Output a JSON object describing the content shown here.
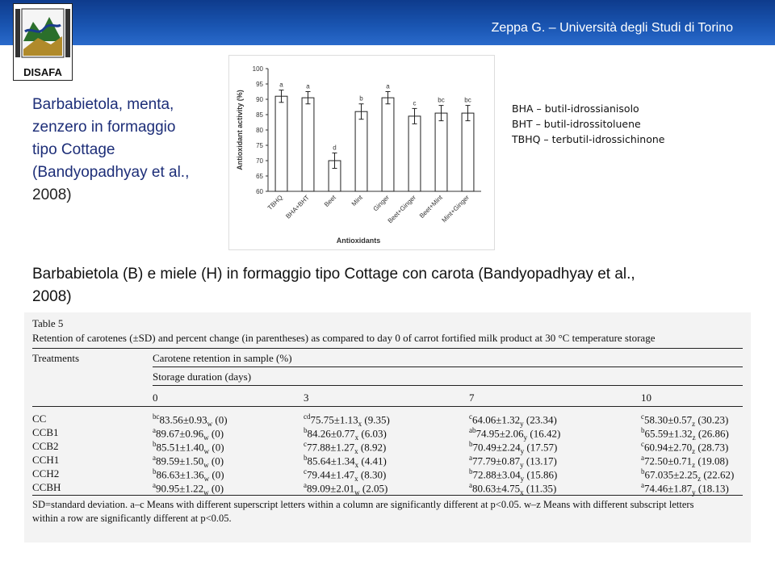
{
  "header": {
    "author_text": "Zeppa G. – Università degli Studi di Torino",
    "logo_text": "DISAFA",
    "logo_ring_text": "UNIVERSITA DEGLI STUDI DI TORINO"
  },
  "left_title": {
    "line1": "Barbabietola, menta,",
    "line2": "zenzero in formaggio",
    "line3": "tipo Cottage",
    "line4": "(Bandyopadhyay et al.,",
    "line5": "2008)"
  },
  "chart_data": {
    "type": "bar",
    "xlabel": "Antioxidants",
    "ylabel": "Antioxidant activity (%)",
    "ylim": [
      60,
      100
    ],
    "yticks": [
      60,
      65,
      70,
      75,
      80,
      85,
      90,
      95,
      100
    ],
    "categories": [
      "TBHQ",
      "BHA+BHT",
      "Beet",
      "Mint",
      "Ginger",
      "Beet+Ginger",
      "Beet+Mint",
      "Mint+Ginger"
    ],
    "values": [
      91,
      90.5,
      70,
      86,
      90.5,
      84.5,
      85.5,
      85.5
    ],
    "errors": [
      2,
      2,
      2.5,
      2.5,
      2,
      2.5,
      2.5,
      2.5
    ],
    "letters": [
      "a",
      "a",
      "d",
      "b",
      "a",
      "c",
      "bc",
      "bc"
    ]
  },
  "legend": {
    "line1": "BHA – butil-idrossianisolo",
    "line2": "BHT – butil-idrossitoluene",
    "line3": "TBHQ – terbutil-idrossichinone"
  },
  "mid_title": {
    "line1": "Barbabietola (B) e miele (H) in formaggio tipo Cottage con carota (Bandyopadhyay et al.,",
    "line2": "2008)"
  },
  "table": {
    "label": "Table 5",
    "caption": "Retention of carotenes (±SD) and percent change (in parentheses) as compared to day 0 of carrot fortified milk product at 30 °C temperature storage",
    "col_treatments": "Treatments",
    "col_retention": "Carotene retention in sample (%)",
    "col_duration": "Storage duration (days)",
    "days": [
      "0",
      "3",
      "7",
      "10"
    ],
    "rows": [
      {
        "name": "CC",
        "cells": [
          [
            "bc",
            "83.56±0.93",
            "w",
            "(0)"
          ],
          [
            "cd",
            "75.75±1.13",
            "x",
            "(9.35)"
          ],
          [
            "c",
            "64.06±1.32",
            "y",
            "(23.34)"
          ],
          [
            "c",
            "58.30±0.57",
            "z",
            "(30.23)"
          ]
        ]
      },
      {
        "name": "CCB1",
        "cells": [
          [
            "a",
            "89.67±0.96",
            "w",
            "(0)"
          ],
          [
            "b",
            "84.26±0.77",
            "x",
            "(6.03)"
          ],
          [
            "ab",
            "74.95±2.06",
            "y",
            "(16.42)"
          ],
          [
            "b",
            "65.59±1.32",
            "z",
            "(26.86)"
          ]
        ]
      },
      {
        "name": "CCB2",
        "cells": [
          [
            "b",
            "85.51±1.40",
            "w",
            "(0)"
          ],
          [
            "c",
            "77.88±1.27",
            "x",
            "(8.92)"
          ],
          [
            "b",
            "70.49±2.24",
            "y",
            "(17.57)"
          ],
          [
            "c",
            "60.94±2.70",
            "z",
            "(28.73)"
          ]
        ]
      },
      {
        "name": "CCH1",
        "cells": [
          [
            "a",
            "89.59±1.50",
            "w",
            "(0)"
          ],
          [
            "b",
            "85.64±1.34",
            "x",
            "(4.41)"
          ],
          [
            "a",
            "77.79±0.87",
            "y",
            "(13.17)"
          ],
          [
            "a",
            "72.50±0.71",
            "z",
            "(19.08)"
          ]
        ]
      },
      {
        "name": "CCH2",
        "cells": [
          [
            "b",
            "86.63±1.36",
            "w",
            "(0)"
          ],
          [
            "c",
            "79.44±1.47",
            "x",
            "(8.30)"
          ],
          [
            "b",
            "72.88±3.04",
            "y",
            "(15.86)"
          ],
          [
            "b",
            "67.035±2.25",
            "z",
            "(22.62)"
          ]
        ]
      },
      {
        "name": "CCBH",
        "cells": [
          [
            "a",
            "90.95±1.22",
            "w",
            "(0)"
          ],
          [
            "a",
            "89.09±2.01",
            "w",
            "(2.05)"
          ],
          [
            "a",
            "80.63±4.75",
            "x",
            "(11.35)"
          ],
          [
            "a",
            "74.46±1.87",
            "y",
            "(18.13)"
          ]
        ]
      }
    ],
    "footnote_line1": "SD=standard deviation. a–c Means with different superscript letters within a column are significantly different at p<0.05. w–z Means with different subscript letters",
    "footnote_line2": "within a row are significantly different at p<0.05."
  }
}
